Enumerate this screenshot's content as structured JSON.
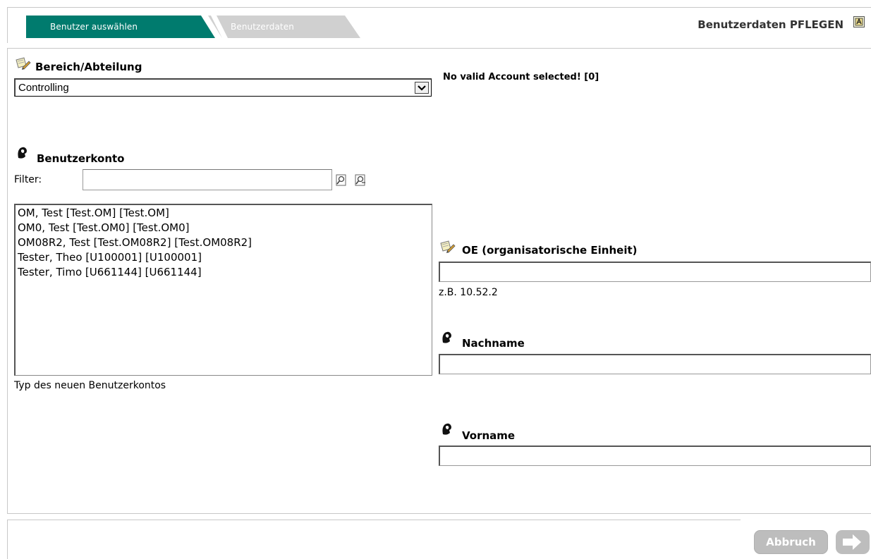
{
  "tabs": [
    {
      "label": "Benutzer auswählen",
      "active": true,
      "color": "#007b6e"
    },
    {
      "label": "Benutzerdaten",
      "active": false,
      "color": "#cfcfcf"
    }
  ],
  "header": {
    "title": "Benutzerdaten PFLEGEN",
    "help_icon": "help-icon"
  },
  "department": {
    "title": "Bereich/Abteilung",
    "icon": "note-icon",
    "selected": "Controlling"
  },
  "status": {
    "message": "No valid Account selected! [0]"
  },
  "account": {
    "title": "Benutzerkonto",
    "icon": "person-icon",
    "filter_label": "Filter:",
    "filter_value": "",
    "items": [
      "OM, Test [Test.OM] [Test.OM]",
      "OM0, Test [Test.OM0] [Test.OM0]",
      "OM08R2, Test [Test.OM08R2] [Test.OM08R2]",
      "Tester, Theo [U100001] [U100001]",
      "Tester, Timo [U661144] [U661144]"
    ],
    "type_hint": "Typ des neuen Benutzerkontos"
  },
  "form": {
    "oe": {
      "label": "OE (organisatorische Einheit)",
      "value": "",
      "hint": "z.B. 10.52.2",
      "icon": "note-icon"
    },
    "lastname": {
      "label": "Nachname",
      "value": "",
      "icon": "person-icon"
    },
    "firstname": {
      "label": "Vorname",
      "value": "",
      "icon": "person-icon"
    }
  },
  "footer": {
    "cancel_label": "Abbruch",
    "next_icon": "arrow-right-icon"
  },
  "colors": {
    "tab_active": "#007b6e",
    "tab_inactive": "#cfcfcf",
    "button_disabled": "#bdbdbd",
    "border": "#c8c8c8"
  }
}
